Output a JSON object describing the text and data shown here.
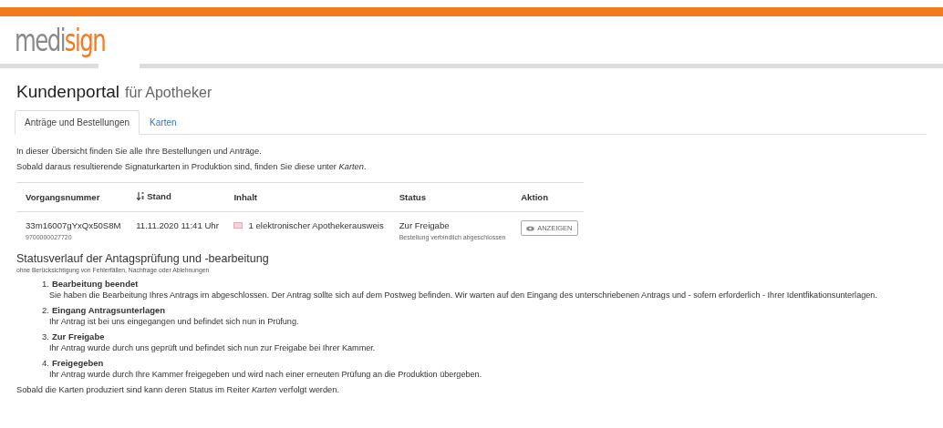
{
  "logo": {
    "part_1": "medi",
    "part_2": "sign"
  },
  "title": {
    "main": "Kundenportal",
    "sub": "für Apotheker"
  },
  "tabs": [
    {
      "label": "Anträge und Bestellungen",
      "selected": true
    },
    {
      "label": "Karten",
      "selected": false
    }
  ],
  "intro": [
    "In dieser Übersicht finden Sie alle Ihre Bestellungen und Anträge.",
    "Sobald daraus resultierende Signaturkarten in Produktion sind, finden Sie diese unter *Karten*."
  ],
  "table": {
    "columns": [
      {
        "label": "Vorgangsnummer",
        "sortable": false
      },
      {
        "label": "Stand",
        "sortable": true
      },
      {
        "label": "Inhalt",
        "sortable": false
      },
      {
        "label": "Status",
        "sortable": false
      },
      {
        "label": "Aktion",
        "sortable": false
      }
    ],
    "rows": [
      {
        "number": "33m16007gYxQx50S8M",
        "sub_number": "9700000027720",
        "date": "11.11.2020 11:41 Uhr",
        "content": "1 elektronischer Apothekerausweis",
        "status": "Zur Freigabe",
        "status_note": "Bestellung verbindlich abgeschlossen",
        "action": "ANZEIGEN"
      }
    ]
  },
  "history": {
    "heading": "Statusverlauf der Antagsprüfung und -bearbeitung",
    "note": "ohne Berücksichtigung von Fehlerfällen, Nachfrage oder Ablehnungen",
    "steps": [
      {
        "number": "1.",
        "title": "Bearbeitung beendet",
        "text": "Sie haben die Bearbeitung Ihres Antrags im abgeschlossen. Der Antrag sollte sich auf dem Postweg befinden. Wir warten auf den Eingang des unterschriebenen Antrags und - sofern erforderlich - Ihrer Identfikationsunterlagen."
      },
      {
        "number": "2.",
        "title": "Eingang Antragsunterlagen",
        "text": "Ihr Antrag ist bei uns eingegangen und befindet sich nun in Prüfung."
      },
      {
        "number": "3.",
        "title": "Zur Freigabe",
        "text": "Ihr Antrag wurde durch uns geprüft und befindet sich nun zur Freigabe bei Ihrer Kammer."
      },
      {
        "number": "4.",
        "title": "Freigegeben",
        "text": "Ihr Antrag wurde durch Ihre Kammer freigegeben und wird nach einer erneuten Prüfung an die Produktion übergeben."
      }
    ],
    "footer": "Sobald die Karten produziert sind kann deren Status im Reiter *Karten* verfolgt werden."
  }
}
